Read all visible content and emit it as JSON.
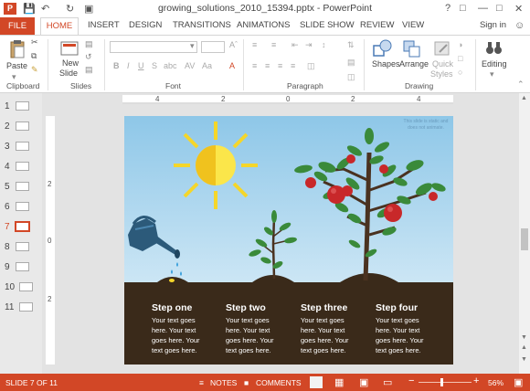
{
  "window": {
    "app_icon_letter": "P",
    "title": "growing_solutions_2010_15394.pptx - PowerPoint"
  },
  "tabs": [
    "FILE",
    "HOME",
    "INSERT",
    "DESIGN",
    "TRANSITIONS",
    "ANIMATIONS",
    "SLIDE SHOW",
    "REVIEW",
    "VIEW"
  ],
  "signin": "Sign in",
  "ribbon": {
    "paste_label": "Paste",
    "new_slide_label_1": "New",
    "new_slide_label_2": "Slide",
    "shapes_label": "Shapes",
    "arrange_label": "Arrange",
    "quick_styles_1": "Quick",
    "quick_styles_2": "Styles",
    "editing_label": "Editing",
    "groups": [
      "Clipboard",
      "Slides",
      "Font",
      "Paragraph",
      "Drawing"
    ]
  },
  "slide_numbers": [
    "1",
    "2",
    "3",
    "4",
    "5",
    "6",
    "7",
    "8",
    "9",
    "10",
    "11"
  ],
  "selected_slide": "7",
  "rulers": {
    "h_ticks": [
      "4",
      "2",
      "0",
      "2",
      "4"
    ],
    "v_ticks": [
      "2",
      "0",
      "2"
    ]
  },
  "slide": {
    "note": [
      "This slide is static and",
      "does not animate."
    ],
    "steps": [
      {
        "title": "Step one",
        "lines": [
          "Your text goes",
          "here. Your text",
          "goes here. Your",
          "text goes here."
        ]
      },
      {
        "title": "Step two",
        "lines": [
          "Your text goes",
          "here. Your text",
          "goes here. Your",
          "text goes here."
        ]
      },
      {
        "title": "Step three",
        "lines": [
          "Your text goes",
          "here. Your text",
          "goes here. Your",
          "text goes here."
        ]
      },
      {
        "title": "Step four",
        "lines": [
          "Your text goes",
          "here. Your text",
          "goes here. Your",
          "text goes here."
        ]
      }
    ]
  },
  "status": {
    "slide_info": "SLIDE 7 OF 11",
    "notes": "NOTES",
    "comments": "COMMENTS",
    "zoom": "56%"
  },
  "colors": {
    "accent": "#d24726",
    "sky_top": "#8ec7e8",
    "soil": "#3a2a1a",
    "sun": "#f5d62a",
    "leaf": "#3a8a3a",
    "apple": "#c8282a",
    "can": "#2c5a7a"
  },
  "icons": [
    "undo-icon",
    "redo-icon",
    "cut-icon",
    "copy-icon",
    "format-painter-icon",
    "help-icon",
    "minimize-icon",
    "maximize-icon",
    "close-icon",
    "notes-icon",
    "comments-icon",
    "normal-view-icon",
    "slide-sorter-icon",
    "reading-view-icon",
    "slideshow-icon"
  ]
}
